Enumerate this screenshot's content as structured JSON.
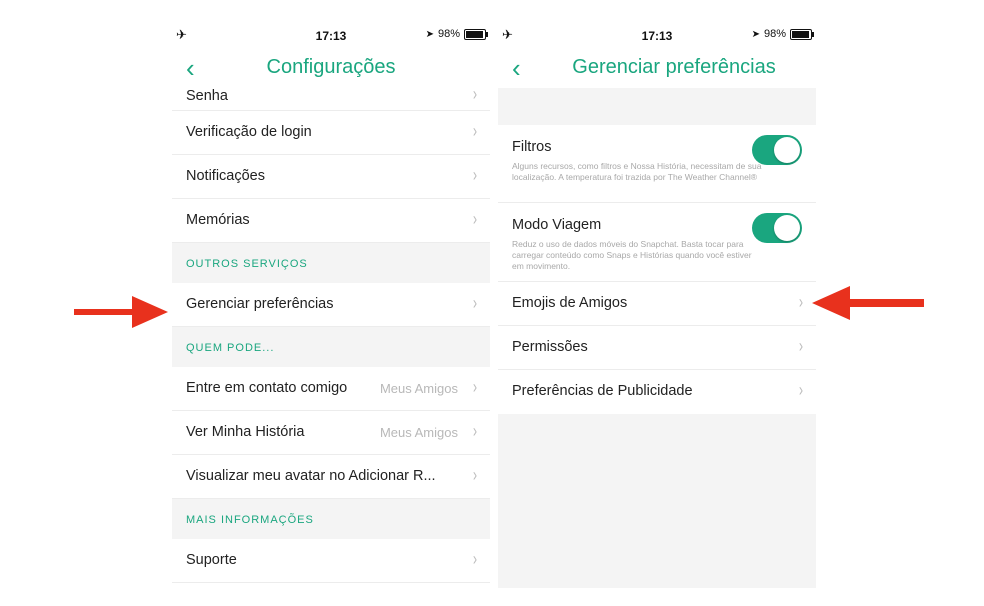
{
  "colors": {
    "accent": "#1aa67f",
    "arrow": "#e8311d",
    "section_bg": "#f4f4f4"
  },
  "left": {
    "status": {
      "icon_left": "airplane-icon",
      "time": "17:13",
      "battery": "98%"
    },
    "nav": {
      "back_icon": "chevron-left-icon",
      "title": "Configurações"
    },
    "rows_top": [
      {
        "label": "Senha"
      },
      {
        "label": "Verificação de login"
      },
      {
        "label": "Notificações"
      },
      {
        "label": "Memórias"
      }
    ],
    "section_outros": "OUTROS SERVIÇOS",
    "row_gerenciar": "Gerenciar preferências",
    "section_quem": "QUEM PODE...",
    "rows_quem": [
      {
        "label": "Entre em contato comigo",
        "value": "Meus Amigos"
      },
      {
        "label": "Ver Minha História",
        "value": "Meus Amigos"
      },
      {
        "label": "Visualizar meu avatar no Adicionar R..."
      }
    ],
    "section_mais": "MAIS INFORMAÇÕES",
    "row_suporte": "Suporte"
  },
  "right": {
    "status": {
      "icon_left": "airplane-icon",
      "time": "17:13",
      "battery": "98%"
    },
    "nav": {
      "back_icon": "chevron-left-icon",
      "title": "Gerenciar preferências"
    },
    "toggles": [
      {
        "label": "Filtros",
        "desc": "Alguns recursos, como filtros e Nossa História, necessitam de sua localização. A temperatura foi trazida por The Weather Channel®",
        "on": true
      },
      {
        "label": "Modo Viagem",
        "desc": "Reduz o uso de dados móveis do Snapchat. Basta tocar para carregar conteúdo como Snaps e Histórias quando você estiver em movimento.",
        "on": true
      }
    ],
    "rows": [
      {
        "label": "Emojis de Amigos"
      },
      {
        "label": "Permissões"
      },
      {
        "label": "Preferências de Publicidade"
      }
    ]
  },
  "chevron": "›"
}
